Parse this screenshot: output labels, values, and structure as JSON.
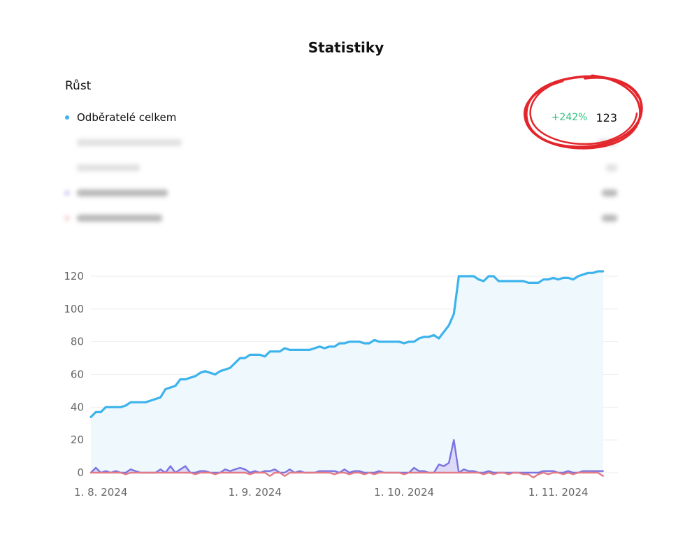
{
  "page": {
    "title": "Statistiky"
  },
  "growth": {
    "section_title": "Růst",
    "metrics": [
      {
        "label": "Odběratelé celkem",
        "change": "+242%",
        "value": "123",
        "dot_color": "#3db3ec",
        "blurred": false
      },
      {
        "label": "",
        "change": "",
        "value": "",
        "dot_color": "",
        "blurred": true
      },
      {
        "label": "",
        "change": "",
        "value": "",
        "dot_color": "",
        "blurred": true
      },
      {
        "label": "",
        "change": "",
        "value": "",
        "dot_color": "#8a86e6",
        "blurred": true
      },
      {
        "label": "",
        "change": "",
        "value": "",
        "dot_color": "#e89a9a",
        "blurred": true
      }
    ]
  },
  "colors": {
    "total": "#3db3ec",
    "total_fill": "#eef8fd",
    "new": "#7b73e0",
    "new_fill": "#dcdaf7",
    "lost": "#e27b85",
    "highlight": "#e3262b",
    "grid": "#eeeeee"
  },
  "chart_data": {
    "type": "area",
    "y_ticks": [
      0,
      20,
      40,
      60,
      80,
      100,
      120
    ],
    "ylim": [
      0,
      123
    ],
    "x_ticks": [
      "1. 8. 2024",
      "1. 9. 2024",
      "1. 10. 2024",
      "1. 11. 2024"
    ],
    "x_tick_days": [
      0,
      31,
      61,
      92
    ],
    "x_range_days": [
      -2,
      104
    ],
    "grid": true,
    "series": [
      {
        "key": "total",
        "values": [
          [
            -2,
            34
          ],
          [
            -1,
            37
          ],
          [
            0,
            37
          ],
          [
            1,
            40
          ],
          [
            2,
            40
          ],
          [
            3,
            40
          ],
          [
            4,
            40
          ],
          [
            5,
            41
          ],
          [
            6,
            43
          ],
          [
            7,
            43
          ],
          [
            8,
            43
          ],
          [
            9,
            43
          ],
          [
            10,
            44
          ],
          [
            11,
            45
          ],
          [
            12,
            46
          ],
          [
            13,
            51
          ],
          [
            14,
            52
          ],
          [
            15,
            53
          ],
          [
            16,
            57
          ],
          [
            17,
            57
          ],
          [
            18,
            58
          ],
          [
            19,
            59
          ],
          [
            20,
            61
          ],
          [
            21,
            62
          ],
          [
            22,
            61
          ],
          [
            23,
            60
          ],
          [
            24,
            62
          ],
          [
            25,
            63
          ],
          [
            26,
            64
          ],
          [
            27,
            67
          ],
          [
            28,
            70
          ],
          [
            29,
            70
          ],
          [
            30,
            72
          ],
          [
            31,
            72
          ],
          [
            32,
            72
          ],
          [
            33,
            71
          ],
          [
            34,
            74
          ],
          [
            35,
            74
          ],
          [
            36,
            74
          ],
          [
            37,
            76
          ],
          [
            38,
            75
          ],
          [
            39,
            75
          ],
          [
            40,
            75
          ],
          [
            41,
            75
          ],
          [
            42,
            75
          ],
          [
            43,
            76
          ],
          [
            44,
            77
          ],
          [
            45,
            76
          ],
          [
            46,
            77
          ],
          [
            47,
            77
          ],
          [
            48,
            79
          ],
          [
            49,
            79
          ],
          [
            50,
            80
          ],
          [
            51,
            80
          ],
          [
            52,
            80
          ],
          [
            53,
            79
          ],
          [
            54,
            79
          ],
          [
            55,
            81
          ],
          [
            56,
            80
          ],
          [
            57,
            80
          ],
          [
            58,
            80
          ],
          [
            59,
            80
          ],
          [
            60,
            80
          ],
          [
            61,
            79
          ],
          [
            62,
            80
          ],
          [
            63,
            80
          ],
          [
            64,
            82
          ],
          [
            65,
            83
          ],
          [
            66,
            83
          ],
          [
            67,
            84
          ],
          [
            68,
            82
          ],
          [
            69,
            86
          ],
          [
            70,
            90
          ],
          [
            71,
            97
          ],
          [
            72,
            120
          ],
          [
            73,
            120
          ],
          [
            74,
            120
          ],
          [
            75,
            120
          ],
          [
            76,
            118
          ],
          [
            77,
            117
          ],
          [
            78,
            120
          ],
          [
            79,
            120
          ],
          [
            80,
            117
          ],
          [
            81,
            117
          ],
          [
            82,
            117
          ],
          [
            83,
            117
          ],
          [
            84,
            117
          ],
          [
            85,
            117
          ],
          [
            86,
            116
          ],
          [
            87,
            116
          ],
          [
            88,
            116
          ],
          [
            89,
            118
          ],
          [
            90,
            118
          ],
          [
            91,
            119
          ],
          [
            92,
            118
          ],
          [
            93,
            119
          ],
          [
            94,
            119
          ],
          [
            95,
            118
          ],
          [
            96,
            120
          ],
          [
            97,
            121
          ],
          [
            98,
            122
          ],
          [
            99,
            122
          ],
          [
            100,
            123
          ],
          [
            101,
            123
          ]
        ]
      },
      {
        "key": "new",
        "values": [
          [
            -2,
            0
          ],
          [
            -1,
            3
          ],
          [
            0,
            0
          ],
          [
            1,
            1
          ],
          [
            2,
            0
          ],
          [
            3,
            1
          ],
          [
            4,
            0
          ],
          [
            5,
            0
          ],
          [
            6,
            2
          ],
          [
            7,
            1
          ],
          [
            8,
            0
          ],
          [
            9,
            0
          ],
          [
            10,
            0
          ],
          [
            11,
            0
          ],
          [
            12,
            2
          ],
          [
            13,
            0
          ],
          [
            14,
            4
          ],
          [
            15,
            0
          ],
          [
            16,
            2
          ],
          [
            17,
            4
          ],
          [
            18,
            0
          ],
          [
            19,
            0
          ],
          [
            20,
            1
          ],
          [
            21,
            1
          ],
          [
            22,
            0
          ],
          [
            23,
            0
          ],
          [
            24,
            0
          ],
          [
            25,
            2
          ],
          [
            26,
            1
          ],
          [
            27,
            2
          ],
          [
            28,
            3
          ],
          [
            29,
            2
          ],
          [
            30,
            0
          ],
          [
            31,
            1
          ],
          [
            32,
            0
          ],
          [
            33,
            1
          ],
          [
            34,
            1
          ],
          [
            35,
            2
          ],
          [
            36,
            0
          ],
          [
            37,
            0
          ],
          [
            38,
            2
          ],
          [
            39,
            0
          ],
          [
            40,
            1
          ],
          [
            41,
            0
          ],
          [
            42,
            0
          ],
          [
            43,
            0
          ],
          [
            44,
            1
          ],
          [
            45,
            1
          ],
          [
            46,
            1
          ],
          [
            47,
            1
          ],
          [
            48,
            0
          ],
          [
            49,
            2
          ],
          [
            50,
            0
          ],
          [
            51,
            1
          ],
          [
            52,
            1
          ],
          [
            53,
            0
          ],
          [
            54,
            0
          ],
          [
            55,
            0
          ],
          [
            56,
            1
          ],
          [
            57,
            0
          ],
          [
            58,
            0
          ],
          [
            59,
            0
          ],
          [
            60,
            0
          ],
          [
            61,
            0
          ],
          [
            62,
            0
          ],
          [
            63,
            3
          ],
          [
            64,
            1
          ],
          [
            65,
            1
          ],
          [
            66,
            0
          ],
          [
            67,
            0
          ],
          [
            68,
            5
          ],
          [
            69,
            4
          ],
          [
            70,
            6
          ],
          [
            71,
            20
          ],
          [
            72,
            0
          ],
          [
            73,
            2
          ],
          [
            74,
            1
          ],
          [
            75,
            1
          ],
          [
            76,
            0
          ],
          [
            77,
            0
          ],
          [
            78,
            1
          ],
          [
            79,
            0
          ],
          [
            80,
            0
          ],
          [
            81,
            0
          ],
          [
            82,
            0
          ],
          [
            83,
            0
          ],
          [
            84,
            0
          ],
          [
            85,
            0
          ],
          [
            86,
            0
          ],
          [
            87,
            0
          ],
          [
            88,
            0
          ],
          [
            89,
            1
          ],
          [
            90,
            1
          ],
          [
            91,
            1
          ],
          [
            92,
            0
          ],
          [
            93,
            0
          ],
          [
            94,
            1
          ],
          [
            95,
            0
          ],
          [
            96,
            0
          ],
          [
            97,
            1
          ],
          [
            98,
            1
          ],
          [
            99,
            1
          ],
          [
            100,
            1
          ],
          [
            101,
            1
          ]
        ]
      },
      {
        "key": "lost",
        "values": [
          [
            -2,
            0
          ],
          [
            -1,
            0
          ],
          [
            0,
            0
          ],
          [
            1,
            0
          ],
          [
            2,
            0
          ],
          [
            3,
            0
          ],
          [
            4,
            0
          ],
          [
            5,
            -1
          ],
          [
            6,
            0
          ],
          [
            7,
            0
          ],
          [
            8,
            0
          ],
          [
            9,
            0
          ],
          [
            10,
            0
          ],
          [
            11,
            0
          ],
          [
            12,
            0
          ],
          [
            13,
            0
          ],
          [
            14,
            0
          ],
          [
            15,
            0
          ],
          [
            16,
            0
          ],
          [
            17,
            0
          ],
          [
            18,
            0
          ],
          [
            19,
            -1
          ],
          [
            20,
            0
          ],
          [
            21,
            0
          ],
          [
            22,
            0
          ],
          [
            23,
            -1
          ],
          [
            24,
            0
          ],
          [
            25,
            0
          ],
          [
            26,
            0
          ],
          [
            27,
            0
          ],
          [
            28,
            0
          ],
          [
            29,
            0
          ],
          [
            30,
            -1
          ],
          [
            31,
            0
          ],
          [
            32,
            0
          ],
          [
            33,
            0
          ],
          [
            34,
            -2
          ],
          [
            35,
            0
          ],
          [
            36,
            0
          ],
          [
            37,
            -2
          ],
          [
            38,
            0
          ],
          [
            39,
            0
          ],
          [
            40,
            0
          ],
          [
            41,
            0
          ],
          [
            42,
            0
          ],
          [
            43,
            0
          ],
          [
            44,
            0
          ],
          [
            45,
            0
          ],
          [
            46,
            0
          ],
          [
            47,
            -1
          ],
          [
            48,
            0
          ],
          [
            49,
            0
          ],
          [
            50,
            -1
          ],
          [
            51,
            0
          ],
          [
            52,
            0
          ],
          [
            53,
            -1
          ],
          [
            54,
            0
          ],
          [
            55,
            -1
          ],
          [
            56,
            0
          ],
          [
            57,
            0
          ],
          [
            58,
            0
          ],
          [
            59,
            0
          ],
          [
            60,
            0
          ],
          [
            61,
            -1
          ],
          [
            62,
            0
          ],
          [
            63,
            0
          ],
          [
            64,
            0
          ],
          [
            65,
            0
          ],
          [
            66,
            0
          ],
          [
            67,
            0
          ],
          [
            68,
            0
          ],
          [
            69,
            0
          ],
          [
            70,
            0
          ],
          [
            71,
            0
          ],
          [
            72,
            0
          ],
          [
            73,
            0
          ],
          [
            74,
            0
          ],
          [
            75,
            0
          ],
          [
            76,
            0
          ],
          [
            77,
            -1
          ],
          [
            78,
            0
          ],
          [
            79,
            -1
          ],
          [
            80,
            0
          ],
          [
            81,
            0
          ],
          [
            82,
            -1
          ],
          [
            83,
            0
          ],
          [
            84,
            0
          ],
          [
            85,
            -1
          ],
          [
            86,
            -1
          ],
          [
            87,
            -3
          ],
          [
            88,
            -1
          ],
          [
            89,
            0
          ],
          [
            90,
            -1
          ],
          [
            91,
            0
          ],
          [
            92,
            0
          ],
          [
            93,
            -1
          ],
          [
            94,
            0
          ],
          [
            95,
            -1
          ],
          [
            96,
            0
          ],
          [
            97,
            0
          ],
          [
            98,
            0
          ],
          [
            99,
            0
          ],
          [
            100,
            0
          ],
          [
            101,
            -2
          ]
        ]
      }
    ]
  }
}
